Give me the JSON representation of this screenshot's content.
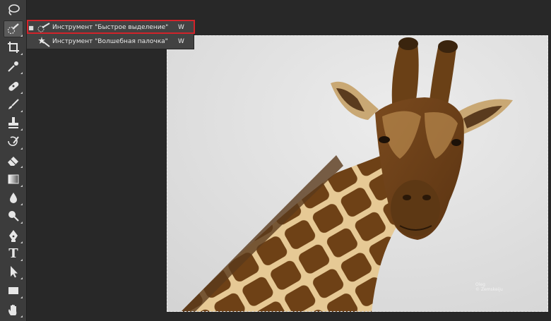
{
  "toolbar": {
    "tools": [
      {
        "name": "lasso",
        "icon": "lasso-icon"
      },
      {
        "name": "quick-selection",
        "icon": "quick-selection-icon",
        "active": true
      },
      {
        "name": "crop",
        "icon": "crop-icon"
      },
      {
        "name": "eyedropper",
        "icon": "eyedropper-icon"
      },
      {
        "name": "healing-brush",
        "icon": "bandage-icon"
      },
      {
        "name": "brush",
        "icon": "brush-icon"
      },
      {
        "name": "clone-stamp",
        "icon": "stamp-icon"
      },
      {
        "name": "history-brush",
        "icon": "history-brush-icon"
      },
      {
        "name": "eraser",
        "icon": "eraser-icon"
      },
      {
        "name": "gradient",
        "icon": "gradient-icon"
      },
      {
        "name": "blur",
        "icon": "drop-icon"
      },
      {
        "name": "dodge",
        "icon": "dodge-icon"
      },
      {
        "name": "pen",
        "icon": "pen-icon"
      },
      {
        "name": "type",
        "icon": "type-icon",
        "glyph": "T"
      },
      {
        "name": "path-selection",
        "icon": "arrow-icon"
      },
      {
        "name": "rectangle",
        "icon": "rectangle-icon"
      },
      {
        "name": "hand",
        "icon": "hand-icon"
      }
    ]
  },
  "flyout": {
    "items": [
      {
        "bullet": "■",
        "label": "Инструмент \"Быстрое выделение\"",
        "shortcut": "W",
        "icon": "quick-selection-icon",
        "selected": true
      },
      {
        "bullet": "",
        "label": "Инструмент \"Волшебная палочка\"",
        "shortcut": "W",
        "icon": "magic-wand-icon",
        "selected": false
      }
    ]
  },
  "watermark": {
    "line1": "Oleg",
    "line2": "© Zemskeiju"
  },
  "colors": {
    "panel": "#3c3c3c",
    "workspace": "#282828",
    "highlight": "#d2232a",
    "canvas_bg": "#dcdcdc"
  }
}
